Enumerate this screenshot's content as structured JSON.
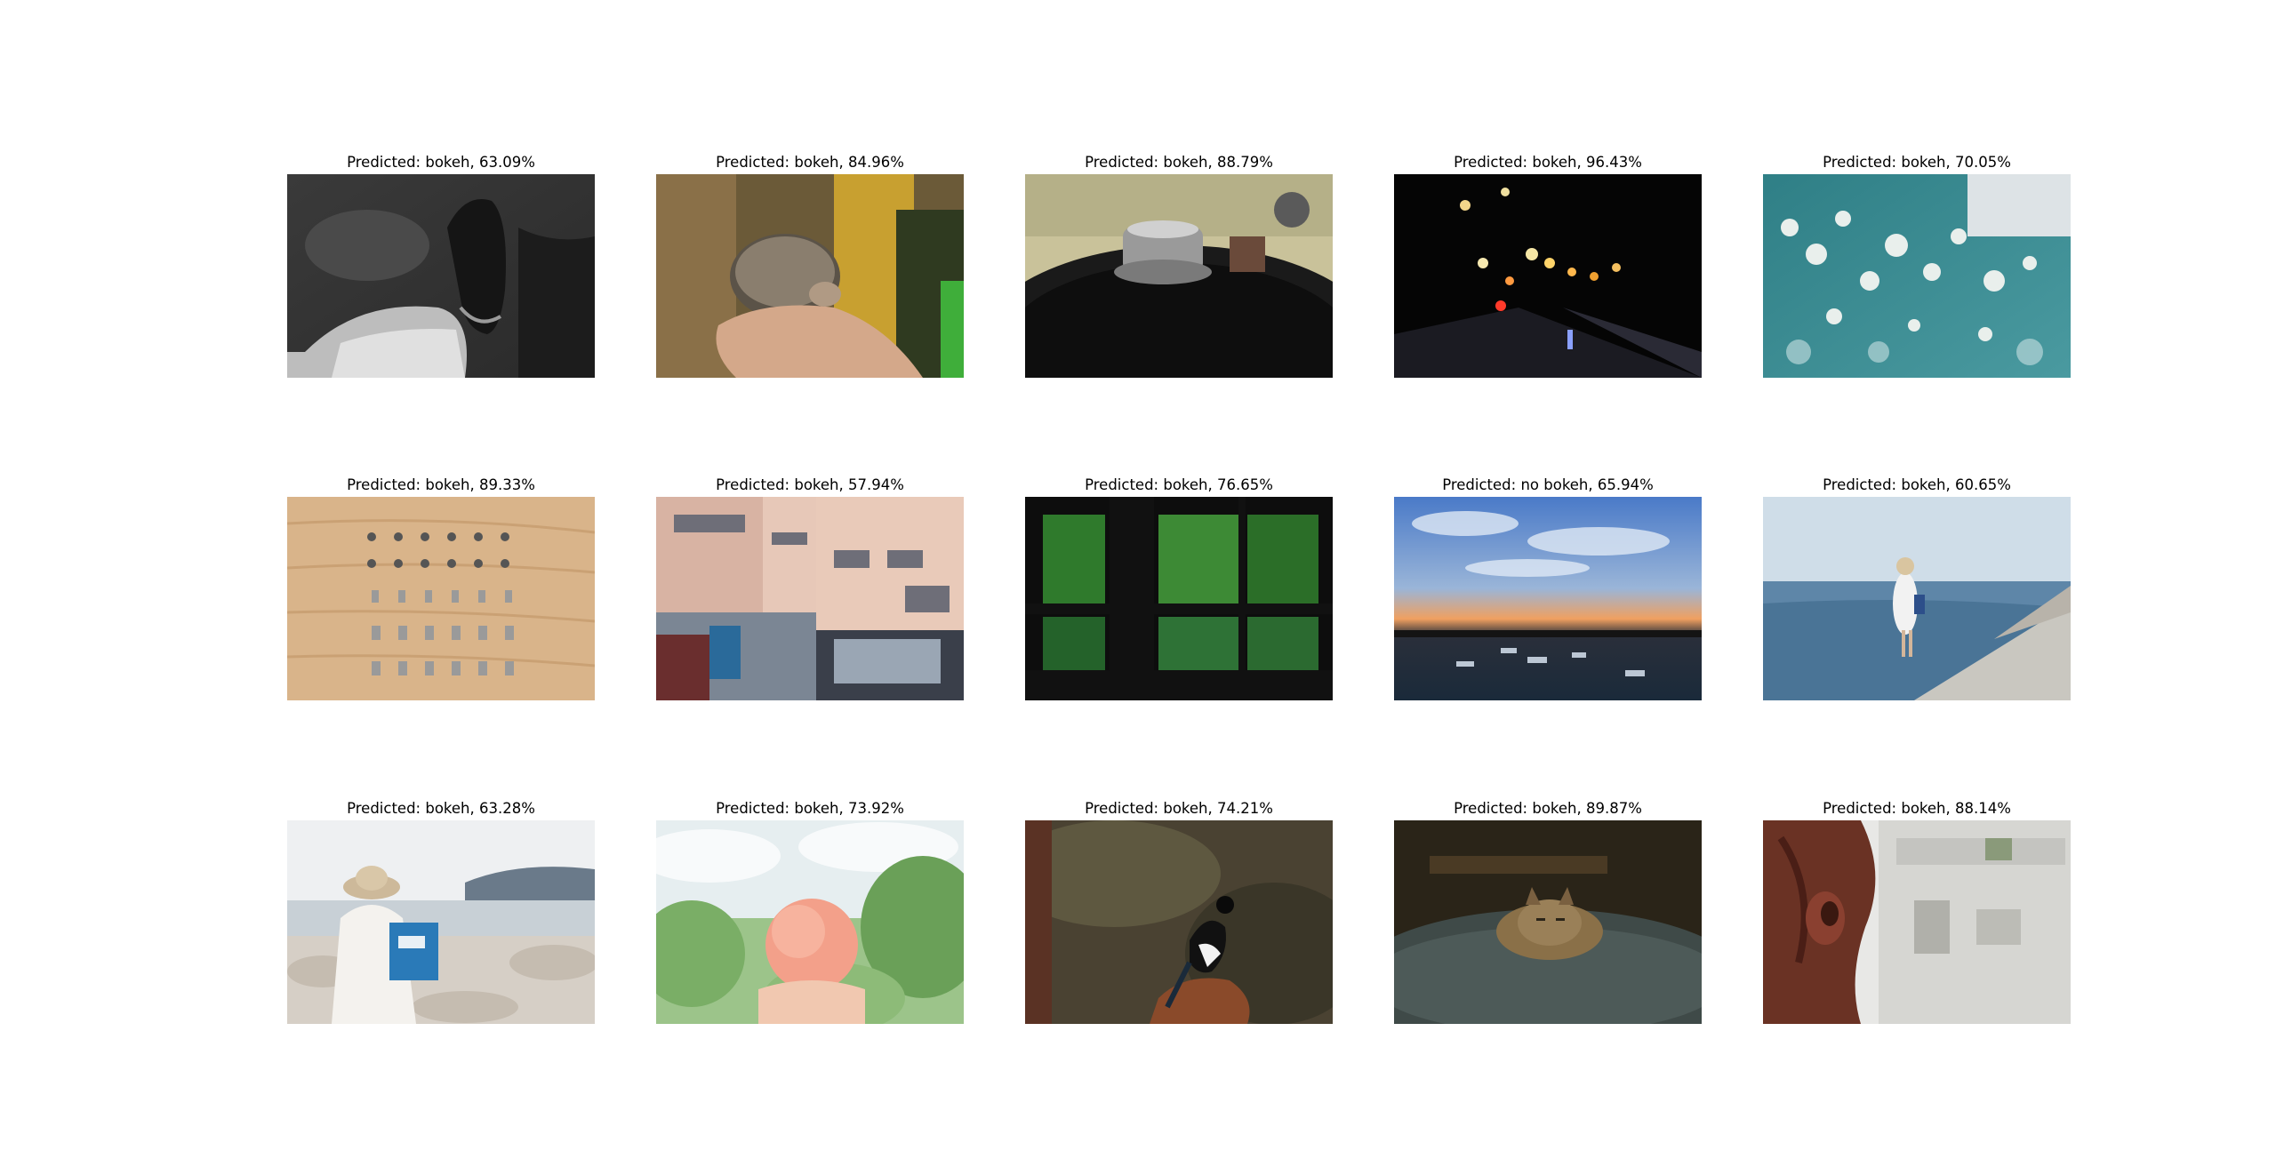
{
  "figure": {
    "images": [
      {
        "caption": "Predicted: bokeh, 63.09%",
        "subject": "black-and-white-shoe"
      },
      {
        "caption": "Predicted: bokeh, 84.96%",
        "subject": "hedgehog-in-hand"
      },
      {
        "caption": "Predicted: bokeh, 88.79%",
        "subject": "record-player"
      },
      {
        "caption": "Predicted: bokeh, 96.43%",
        "subject": "night-street-lights"
      },
      {
        "caption": "Predicted: bokeh, 70.05%",
        "subject": "white-blossoms"
      },
      {
        "caption": "Predicted: bokeh, 89.33%",
        "subject": "metal-pieces-on-wood"
      },
      {
        "caption": "Predicted: bokeh, 57.94%",
        "subject": "building-facade"
      },
      {
        "caption": "Predicted: bokeh, 76.65%",
        "subject": "window-forest-view"
      },
      {
        "caption": "Predicted: no bokeh, 65.94%",
        "subject": "harbor-sunset"
      },
      {
        "caption": "Predicted: bokeh, 60.65%",
        "subject": "woman-on-seawall"
      },
      {
        "caption": "Predicted: bokeh, 63.28%",
        "subject": "woman-with-bag-on-rocks"
      },
      {
        "caption": "Predicted: bokeh, 73.92%",
        "subject": "hands-holding-peach"
      },
      {
        "caption": "Predicted: bokeh, 74.21%",
        "subject": "magpie-on-rock"
      },
      {
        "caption": "Predicted: bokeh, 89.87%",
        "subject": "cat-on-car-roof"
      },
      {
        "caption": "Predicted: bokeh, 88.14%",
        "subject": "tree-bark"
      }
    ]
  }
}
